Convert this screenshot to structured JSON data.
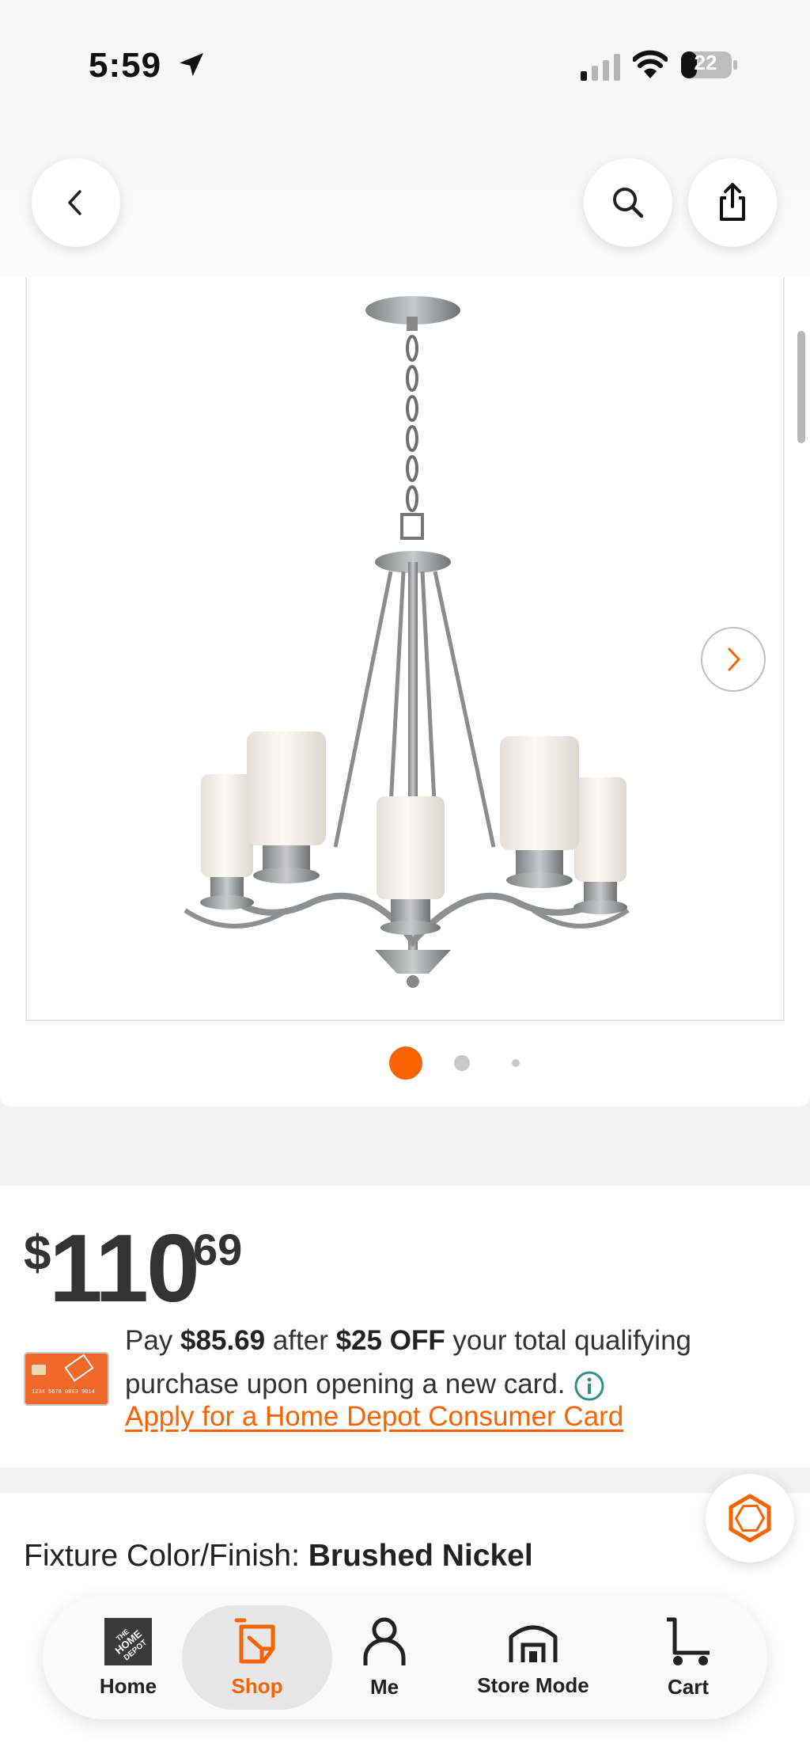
{
  "status_bar": {
    "time": "5:59",
    "battery": "22"
  },
  "header": {
    "back_icon": "chevron-left-icon",
    "search_icon": "search-icon",
    "share_icon": "share-icon"
  },
  "gallery": {
    "image_subject": "five-light brushed nickel chandelier with white glass shades",
    "image_count": 3,
    "active_index": 0,
    "next_icon": "chevron-right-icon"
  },
  "price": {
    "currency": "$",
    "dollars": "110",
    "cents": "69"
  },
  "promo": {
    "pay_prefix": "Pay ",
    "pay_amount": "$85.69",
    "after": " after ",
    "discount": "$25 OFF",
    "rest": " your total qualifying purchase upon opening a new card.",
    "link_label": "Apply for a Home Depot Consumer Card",
    "card_number": "1234 5678 0063 9014"
  },
  "fixture": {
    "label": "Fixture Color/Finish: ",
    "value": "Brushed Nickel"
  },
  "bottom_nav": {
    "items": [
      {
        "label": "Home",
        "icon": "home-depot-logo-icon"
      },
      {
        "label": "Shop",
        "icon": "shop-icon"
      },
      {
        "label": "Me",
        "icon": "user-icon"
      },
      {
        "label": "Store Mode",
        "icon": "store-icon"
      },
      {
        "label": "Cart",
        "icon": "cart-icon"
      }
    ],
    "active": "Shop"
  },
  "colors": {
    "brand_orange": "#f96302",
    "text_dark": "#222222",
    "info_teal": "#2f8f8a"
  }
}
